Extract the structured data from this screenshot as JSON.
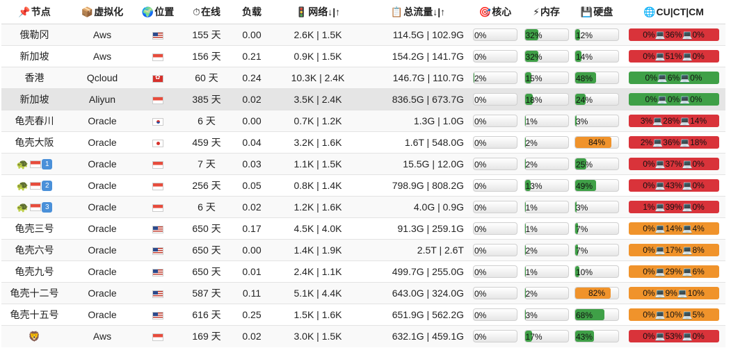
{
  "headers": {
    "node": "节点",
    "virt": "虚拟化",
    "location": "位置",
    "uptime": "在线",
    "load": "负载",
    "network": "网络↓|↑",
    "traffic": "总流量↓|↑",
    "cpu": "核心",
    "mem": "内存",
    "disk": "硬盘",
    "ping": "CU|CT|CM"
  },
  "rows": [
    {
      "name": "俄勒冈",
      "virt": "Aws",
      "flag": "us",
      "uptime": "155 天",
      "load": "0.00",
      "net": "2.6K | 1.5K",
      "traffic": "114.5G | 102.9G",
      "cpu": "0%",
      "cpu_pct": 0,
      "mem": "32%",
      "mem_pct": 32,
      "mem_color": "green",
      "disk": "12%",
      "disk_pct": 12,
      "disk_color": "green",
      "ping": "0%💻36%💻0%",
      "ping_color": "red",
      "highlight": false
    },
    {
      "name": "新加坡",
      "virt": "Aws",
      "flag": "sg",
      "uptime": "156 天",
      "load": "0.21",
      "net": "0.9K | 1.5K",
      "traffic": "154.2G | 141.7G",
      "cpu": "0%",
      "cpu_pct": 0,
      "mem": "32%",
      "mem_pct": 32,
      "mem_color": "green",
      "disk": "14%",
      "disk_pct": 14,
      "disk_color": "green",
      "ping": "0%💻51%💻0%",
      "ping_color": "red",
      "highlight": false
    },
    {
      "name": "香港",
      "virt": "Qcloud",
      "flag": "hk",
      "uptime": "60 天",
      "load": "0.24",
      "net": "10.3K | 2.4K",
      "traffic": "146.7G | 110.7G",
      "cpu": "2%",
      "cpu_pct": 2,
      "mem": "15%",
      "mem_pct": 15,
      "mem_color": "green",
      "disk": "48%",
      "disk_pct": 48,
      "disk_color": "green",
      "ping": "0%💻6%💻0%",
      "ping_color": "green",
      "highlight": false
    },
    {
      "name": "新加坡",
      "virt": "Aliyun",
      "flag": "sg",
      "uptime": "385 天",
      "load": "0.02",
      "net": "3.5K | 2.4K",
      "traffic": "836.5G | 673.7G",
      "cpu": "0%",
      "cpu_pct": 0,
      "mem": "18%",
      "mem_pct": 18,
      "mem_color": "green",
      "disk": "24%",
      "disk_pct": 24,
      "disk_color": "green",
      "ping": "0%💻0%💻0%",
      "ping_color": "green",
      "highlight": true
    },
    {
      "name": "龟壳春川",
      "virt": "Oracle",
      "flag": "kr",
      "uptime": "6 天",
      "load": "0.00",
      "net": "0.7K | 1.2K",
      "traffic": "1.3G | 1.0G",
      "cpu": "0%",
      "cpu_pct": 0,
      "mem": "1%",
      "mem_pct": 1,
      "mem_color": "green",
      "disk": "3%",
      "disk_pct": 3,
      "disk_color": "green",
      "ping": "3%💻28%💻14%",
      "ping_color": "red",
      "highlight": false
    },
    {
      "name": "龟壳大阪",
      "virt": "Oracle",
      "flag": "jp",
      "uptime": "459 天",
      "load": "0.04",
      "net": "3.2K | 1.6K",
      "traffic": "1.6T | 548.0G",
      "cpu": "0%",
      "cpu_pct": 0,
      "mem": "2%",
      "mem_pct": 2,
      "mem_color": "green",
      "disk": "84%",
      "disk_pct": 84,
      "disk_color": "orange",
      "ping": "2%💻36%💻18%",
      "ping_color": "red",
      "highlight": false
    },
    {
      "name": "🐢",
      "tag": "1",
      "virt": "Oracle",
      "flag": "sg",
      "uptime": "7 天",
      "load": "0.03",
      "net": "1.1K | 1.5K",
      "traffic": "15.5G | 12.0G",
      "cpu": "0%",
      "cpu_pct": 0,
      "mem": "2%",
      "mem_pct": 2,
      "mem_color": "green",
      "disk": "25%",
      "disk_pct": 25,
      "disk_color": "green",
      "ping": "0%💻37%💻0%",
      "ping_color": "red",
      "highlight": false
    },
    {
      "name": "🐢",
      "tag": "2",
      "virt": "Oracle",
      "flag": "sg",
      "uptime": "256 天",
      "load": "0.05",
      "net": "0.8K | 1.4K",
      "traffic": "798.9G | 808.2G",
      "cpu": "0%",
      "cpu_pct": 0,
      "mem": "13%",
      "mem_pct": 13,
      "mem_color": "green",
      "disk": "49%",
      "disk_pct": 49,
      "disk_color": "green",
      "ping": "0%💻43%💻0%",
      "ping_color": "red",
      "highlight": false
    },
    {
      "name": "🐢",
      "tag": "3",
      "virt": "Oracle",
      "flag": "sg",
      "uptime": "6 天",
      "load": "0.02",
      "net": "1.2K | 1.6K",
      "traffic": "4.0G | 0.9G",
      "cpu": "0%",
      "cpu_pct": 0,
      "mem": "1%",
      "mem_pct": 1,
      "mem_color": "green",
      "disk": "3%",
      "disk_pct": 3,
      "disk_color": "green",
      "ping": "1%💻39%💻0%",
      "ping_color": "red",
      "highlight": false
    },
    {
      "name": "龟壳三号",
      "virt": "Oracle",
      "flag": "us",
      "uptime": "650 天",
      "load": "0.17",
      "net": "4.5K | 4.0K",
      "traffic": "91.3G | 259.1G",
      "cpu": "0%",
      "cpu_pct": 0,
      "mem": "1%",
      "mem_pct": 1,
      "mem_color": "green",
      "disk": "7%",
      "disk_pct": 7,
      "disk_color": "green",
      "ping": "0%💻14%💻4%",
      "ping_color": "orange",
      "highlight": false
    },
    {
      "name": "龟壳六号",
      "virt": "Oracle",
      "flag": "us",
      "uptime": "650 天",
      "load": "0.00",
      "net": "1.4K | 1.9K",
      "traffic": "2.5T | 2.6T",
      "cpu": "0%",
      "cpu_pct": 0,
      "mem": "2%",
      "mem_pct": 2,
      "mem_color": "green",
      "disk": "7%",
      "disk_pct": 7,
      "disk_color": "green",
      "ping": "0%💻17%💻8%",
      "ping_color": "orange",
      "highlight": false
    },
    {
      "name": "龟壳九号",
      "virt": "Oracle",
      "flag": "us",
      "uptime": "650 天",
      "load": "0.01",
      "net": "2.4K | 1.1K",
      "traffic": "499.7G | 255.0G",
      "cpu": "0%",
      "cpu_pct": 0,
      "mem": "1%",
      "mem_pct": 1,
      "mem_color": "green",
      "disk": "10%",
      "disk_pct": 10,
      "disk_color": "green",
      "ping": "0%💻29%💻6%",
      "ping_color": "orange",
      "highlight": false
    },
    {
      "name": "龟壳十二号",
      "virt": "Oracle",
      "flag": "us",
      "uptime": "587 天",
      "load": "0.11",
      "net": "5.1K | 4.4K",
      "traffic": "643.0G | 324.0G",
      "cpu": "0%",
      "cpu_pct": 0,
      "mem": "2%",
      "mem_pct": 2,
      "mem_color": "green",
      "disk": "82%",
      "disk_pct": 82,
      "disk_color": "orange",
      "ping": "0%💻9%💻10%",
      "ping_color": "orange",
      "highlight": false
    },
    {
      "name": "龟壳十五号",
      "virt": "Oracle",
      "flag": "us",
      "uptime": "616 天",
      "load": "0.25",
      "net": "1.5K | 1.6K",
      "traffic": "651.9G | 562.2G",
      "cpu": "0%",
      "cpu_pct": 0,
      "mem": "3%",
      "mem_pct": 3,
      "mem_color": "green",
      "disk": "68%",
      "disk_pct": 68,
      "disk_color": "green",
      "ping": "0%💻10%💻5%",
      "ping_color": "orange",
      "highlight": false
    },
    {
      "name": "🦁",
      "virt": "Aws",
      "flag": "sg",
      "uptime": "169 天",
      "load": "0.02",
      "net": "3.0K | 1.5K",
      "traffic": "632.1G | 459.1G",
      "cpu": "0%",
      "cpu_pct": 0,
      "mem": "17%",
      "mem_pct": 17,
      "mem_color": "green",
      "disk": "43%",
      "disk_pct": 43,
      "disk_color": "green",
      "ping": "0%💻53%💻0%",
      "ping_color": "red",
      "highlight": false
    }
  ]
}
